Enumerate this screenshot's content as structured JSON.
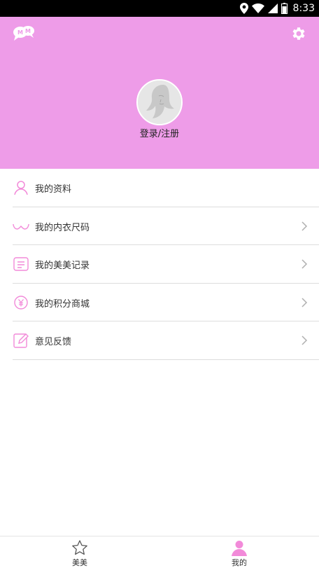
{
  "status_bar": {
    "time": "8:33"
  },
  "header": {
    "logo_icon": "mm-chat-bubbles-logo",
    "settings_icon": "gear-icon",
    "login_label": "登录/注册",
    "background_color": "#ee9ce8"
  },
  "menu": {
    "items": [
      {
        "label": "我的资料",
        "icon": "person-icon",
        "has_chevron": false
      },
      {
        "label": "我的内衣尺码",
        "icon": "bra-icon",
        "has_chevron": true
      },
      {
        "label": "我的美美记录",
        "icon": "notes-icon",
        "has_chevron": true
      },
      {
        "label": "我的积分商城",
        "icon": "yen-coin-icon",
        "has_chevron": true
      },
      {
        "label": "意见反馈",
        "icon": "edit-icon",
        "has_chevron": true
      }
    ]
  },
  "bottom_nav": {
    "tabs": [
      {
        "label": "美美",
        "icon": "star-icon",
        "active": false
      },
      {
        "label": "我的",
        "icon": "person-filled-icon",
        "active": true
      }
    ],
    "active_color": "#f28ad9"
  }
}
